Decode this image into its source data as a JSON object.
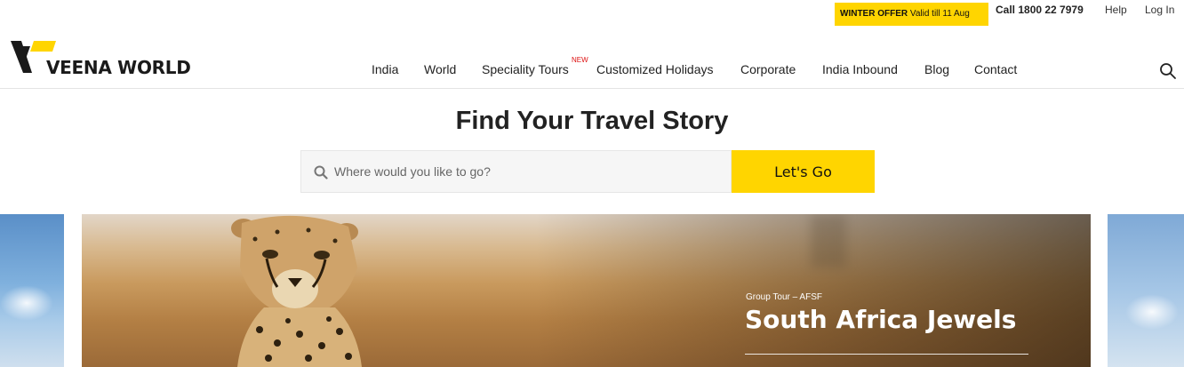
{
  "topbar": {
    "offer_title": "WINTER OFFER",
    "offer_text": "Valid till 11 Aug",
    "call": "Call 1800 22 7979",
    "help": "Help",
    "login": "Log In",
    "accent_color": "#ffd500"
  },
  "logo": {
    "text": "VEENA WORLD"
  },
  "nav": {
    "items": [
      "India",
      "World",
      "Speciality Tours",
      "Customized Holidays",
      "Corporate",
      "India Inbound",
      "Blog",
      "Contact"
    ],
    "new_badge": "NEW",
    "search_icon": "search-icon"
  },
  "hero": {
    "title": "Find Your Travel Story",
    "search_placeholder": "Where would you like to go?",
    "button_label": "Let's Go"
  },
  "carousel": {
    "tour_type": "Group Tour –  AFSF",
    "tour_name": "South Africa Jewels",
    "prev_icon": "chevron-left-icon",
    "next_icon": "chevron-right-icon"
  }
}
